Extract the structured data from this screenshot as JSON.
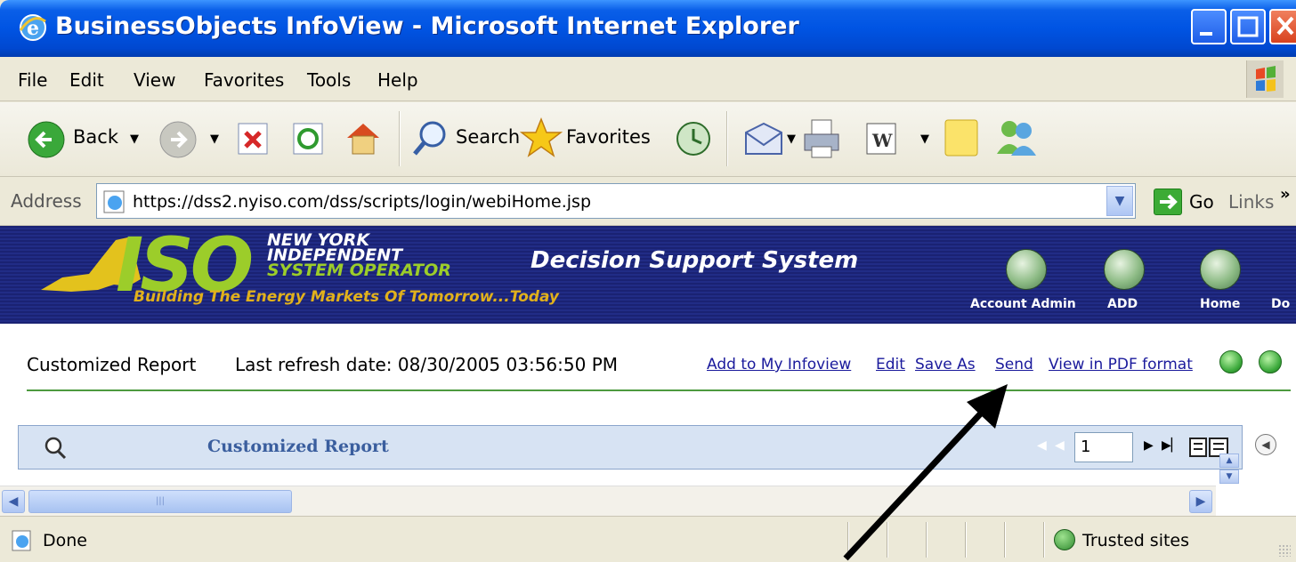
{
  "window": {
    "title": "BusinessObjects InfoView - Microsoft Internet Explorer"
  },
  "menu": {
    "items": [
      "File",
      "Edit",
      "View",
      "Favorites",
      "Tools",
      "Help"
    ]
  },
  "toolbar": {
    "back_label": "Back",
    "search_label": "Search",
    "favorites_label": "Favorites"
  },
  "address": {
    "label": "Address",
    "url": "https://dss2.nyiso.com/dss/scripts/login/webiHome.jsp",
    "go_label": "Go",
    "links_label": "Links"
  },
  "banner": {
    "logo_text": "ISO",
    "org_lines": [
      "NEW YORK",
      "INDEPENDENT",
      "SYSTEM OPERATOR"
    ],
    "tagline": "Building The Energy Markets Of Tomorrow...Today",
    "app_title": "Decision Support System",
    "nav": [
      "Account Admin",
      "ADD",
      "Home",
      "Do"
    ]
  },
  "report": {
    "name": "Customized Report",
    "refresh": "Last refresh date: 08/30/2005 03:56:50 PM",
    "actions": [
      "Add to My Infoview",
      "Edit",
      "Save As",
      "Send",
      "View in PDF format"
    ],
    "bar_title": "Customized Report",
    "page_number": "1"
  },
  "status": {
    "text": "Done",
    "zone": "Trusted sites"
  }
}
